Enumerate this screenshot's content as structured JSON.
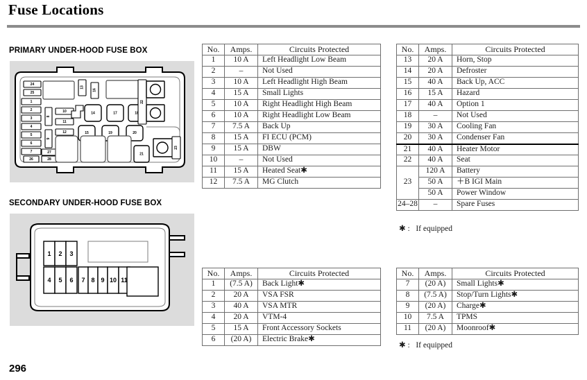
{
  "page": {
    "title": "Fuse Locations",
    "number": "296"
  },
  "sections": {
    "primary_heading": "PRIMARY UNDER-HOOD FUSE BOX",
    "secondary_heading": "SECONDARY UNDER-HOOD FUSE BOX"
  },
  "footnotes": {
    "upper": "✱ :   If equipped",
    "lower": "✱ :   If equipped"
  },
  "table_headers": {
    "no": "No.",
    "amps": "Amps.",
    "circuits": "Circuits Protected"
  },
  "tables": {
    "primary_left": [
      {
        "no": "1",
        "amps": "10 A",
        "circuit": "Left Headlight Low Beam"
      },
      {
        "no": "2",
        "amps": "–",
        "circuit": "Not Used"
      },
      {
        "no": "3",
        "amps": "10 A",
        "circuit": "Left Headlight High Beam"
      },
      {
        "no": "4",
        "amps": "15 A",
        "circuit": "Small Lights"
      },
      {
        "no": "5",
        "amps": "10 A",
        "circuit": "Right Headlight High Beam"
      },
      {
        "no": "6",
        "amps": "10 A",
        "circuit": "Right Headlight Low Beam"
      },
      {
        "no": "7",
        "amps": "7.5 A",
        "circuit": "Back Up"
      },
      {
        "no": "8",
        "amps": "15 A",
        "circuit": "FI ECU (PCM)"
      },
      {
        "no": "9",
        "amps": "15 A",
        "circuit": "DBW"
      },
      {
        "no": "10",
        "amps": "–",
        "circuit": "Not Used"
      },
      {
        "no": "11",
        "amps": "15 A",
        "circuit": "Heated Seat✱"
      },
      {
        "no": "12",
        "amps": "7.5 A",
        "circuit": "MG Clutch"
      }
    ],
    "primary_right": [
      {
        "no": "13",
        "amps": "20 A",
        "circuit": "Horn, Stop"
      },
      {
        "no": "14",
        "amps": "20 A",
        "circuit": "Defroster"
      },
      {
        "no": "15",
        "amps": "40 A",
        "circuit": "Back Up, ACC"
      },
      {
        "no": "16",
        "amps": "15 A",
        "circuit": "Hazard"
      },
      {
        "no": "17",
        "amps": "40 A",
        "circuit": "Option 1"
      },
      {
        "no": "18",
        "amps": "–",
        "circuit": "Not Used"
      },
      {
        "no": "19",
        "amps": "30 A",
        "circuit": "Cooling Fan"
      },
      {
        "no": "20",
        "amps": "30 A",
        "circuit": "Condenser Fan"
      },
      {
        "no": "21",
        "amps": "40 A",
        "circuit": "Heater Motor",
        "thick_top": true
      },
      {
        "no": "22",
        "amps": "40 A",
        "circuit": "Seat"
      },
      {
        "no": "23",
        "amps": "120 A",
        "circuit": "Battery",
        "group_start": true,
        "group_rows": 3
      },
      {
        "no": "",
        "amps": "50 A",
        "circuit": "＋B IGI Main"
      },
      {
        "no": "",
        "amps": "50 A",
        "circuit": "Power Window"
      },
      {
        "no": "24–28",
        "amps": "–",
        "circuit": "Spare Fuses"
      }
    ],
    "secondary_left": [
      {
        "no": "1",
        "amps": "(7.5 A)",
        "circuit": "Back Light✱"
      },
      {
        "no": "2",
        "amps": "20 A",
        "circuit": "VSA FSR"
      },
      {
        "no": "3",
        "amps": "40 A",
        "circuit": "VSA MTR"
      },
      {
        "no": "4",
        "amps": "20 A",
        "circuit": "VTM-4"
      },
      {
        "no": "5",
        "amps": "15 A",
        "circuit": "Front Accessory Sockets"
      },
      {
        "no": "6",
        "amps": "(20 A)",
        "circuit": "Electric Brake✱"
      }
    ],
    "secondary_right": [
      {
        "no": "7",
        "amps": "(20 A)",
        "circuit": "Small Lights✱"
      },
      {
        "no": "8",
        "amps": "(7.5 A)",
        "circuit": "Stop/Turn Lights✱"
      },
      {
        "no": "9",
        "amps": "(20 A)",
        "circuit": "Charge✱"
      },
      {
        "no": "10",
        "amps": "7.5 A",
        "circuit": "TPMS"
      },
      {
        "no": "11",
        "amps": "(20 A)",
        "circuit": "Moonroof✱"
      }
    ]
  },
  "diagrams": {
    "primary_fuse_box": {
      "label": "primary-under-hood-fuse-box-diagram",
      "slot_numbers": [
        "24",
        "25",
        "1",
        "2",
        "3",
        "4",
        "5",
        "6",
        "7",
        "26",
        "27",
        "28",
        "8",
        "9",
        "10",
        "11",
        "12",
        "13",
        "16",
        "14",
        "17",
        "18",
        "15",
        "19",
        "20",
        "21",
        "22",
        "23"
      ]
    },
    "secondary_fuse_box": {
      "label": "secondary-under-hood-fuse-box-diagram",
      "row_top": [
        "1",
        "2",
        "3"
      ],
      "row_bottom": [
        "4",
        "5",
        "6",
        "7",
        "8",
        "9",
        "10",
        "11"
      ]
    }
  },
  "colors": {
    "panel_background": "#dcdcdc",
    "rule": "#8c8c8c",
    "table_border": "#6e6e6e",
    "text": "#1a1a1a"
  }
}
